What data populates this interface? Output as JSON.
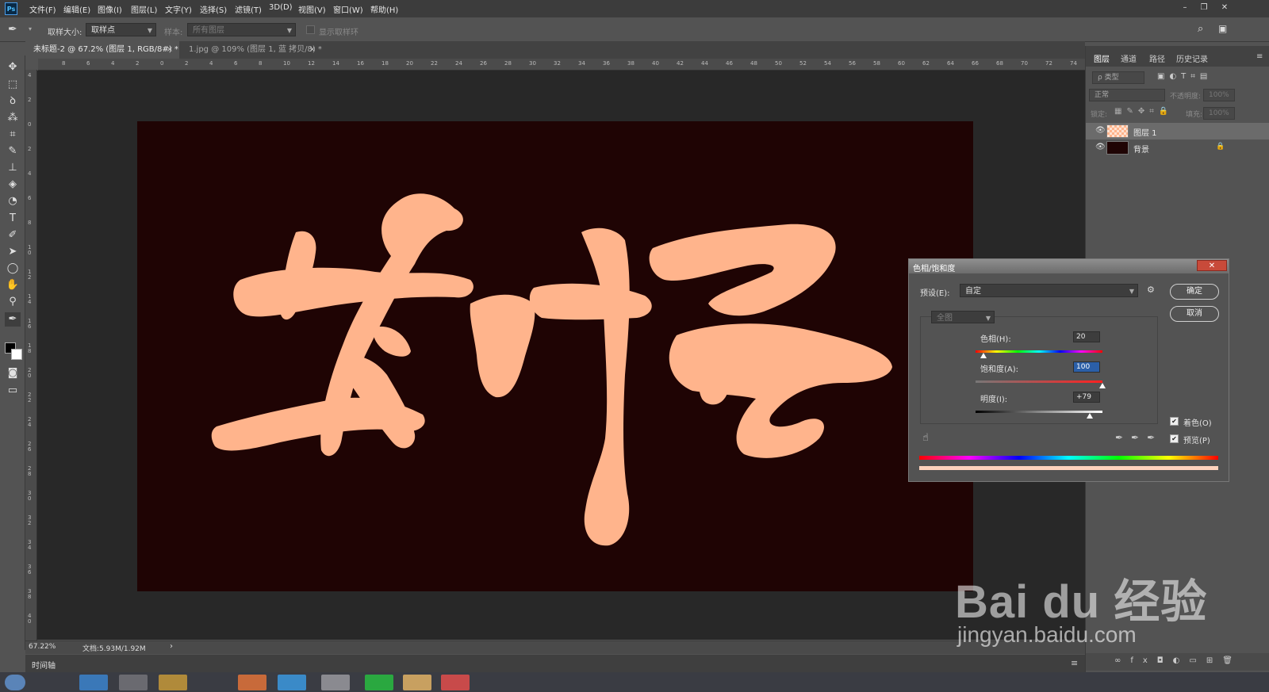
{
  "app": {
    "logo": "Ps"
  },
  "menubar": {
    "items": [
      "文件(F)",
      "编辑(E)",
      "图像(I)",
      "图层(L)",
      "文字(Y)",
      "选择(S)",
      "滤镜(T)",
      "3D(D)",
      "视图(V)",
      "窗口(W)",
      "帮助(H)"
    ]
  },
  "options": {
    "sample_size_label": "取样大小:",
    "sample_size_value": "取样点",
    "sample_label": "样本:",
    "sample_value": "所有图层",
    "show_ring_label": "显示取样环"
  },
  "tabs": [
    {
      "label": "未标题-2 @ 67.2% (图层 1, RGB/8#) *",
      "close": "×"
    },
    {
      "label": "1.jpg @ 109% (图层 1, 蓝 拷贝/8) *",
      "close": "×"
    }
  ],
  "ruler_h": [
    "8",
    "6",
    "4",
    "2",
    "0",
    "2",
    "4",
    "6",
    "8",
    "10",
    "12",
    "14",
    "16",
    "18",
    "20",
    "22",
    "24",
    "26",
    "28",
    "30",
    "32",
    "34",
    "36",
    "38",
    "40",
    "42",
    "44",
    "46",
    "48",
    "50",
    "52",
    "54",
    "56",
    "58",
    "60",
    "62",
    "64",
    "66",
    "68",
    "70",
    "72",
    "74"
  ],
  "ruler_v": [
    "4",
    "2",
    "0",
    "2",
    "4",
    "6",
    "8",
    "1 0",
    "1 2",
    "1 4",
    "1 6",
    "1 8",
    "2 0",
    "2 2",
    "2 4",
    "2 6",
    "2 8",
    "3 0",
    "3 2",
    "3 4",
    "3 6",
    "3 8",
    "4 0"
  ],
  "canvas": {
    "background": "#1f0404",
    "text_color": "#ffb48c"
  },
  "status": {
    "zoom": "67.22%",
    "doc_info": "文档:5.93M/1.92M",
    "arrow": "›"
  },
  "timeline": {
    "label": "时间轴"
  },
  "panel": {
    "tabs": [
      "图层",
      "通道",
      "路径",
      "历史记录"
    ],
    "filter_placeholder": "ρ 类型",
    "blend_mode": "正常",
    "opacity_label": "不透明度:",
    "opacity_value": "100%",
    "lock_label": "锁定:",
    "fill_label": "填充:",
    "fill_value": "100%",
    "layers": [
      {
        "name": "图层 1",
        "selected": true,
        "thumb": "checker"
      },
      {
        "name": "背景",
        "selected": false,
        "thumb": "#1f0404",
        "locked": true
      }
    ]
  },
  "dialog": {
    "title": "色相/饱和度",
    "close": "✕",
    "preset_label": "预设(E):",
    "preset_value": "自定",
    "channel_value": "全图",
    "hue_label": "色相(H):",
    "hue_value": "20",
    "saturation_label": "饱和度(A):",
    "saturation_value": "100",
    "lightness_label": "明度(I):",
    "lightness_value": "+79",
    "ok": "确定",
    "cancel": "取消",
    "colorize_label": "着色(O)",
    "preview_label": "预览(P)",
    "colorize_checked": true,
    "preview_checked": true,
    "hue_slider_pos": 0.06,
    "sat_slider_pos": 1.0,
    "light_slider_pos": 0.9,
    "result_color": "#ffd2bd"
  },
  "watermark": {
    "brand": "Bai du 经验",
    "url": "jingyan.baidu.com"
  }
}
